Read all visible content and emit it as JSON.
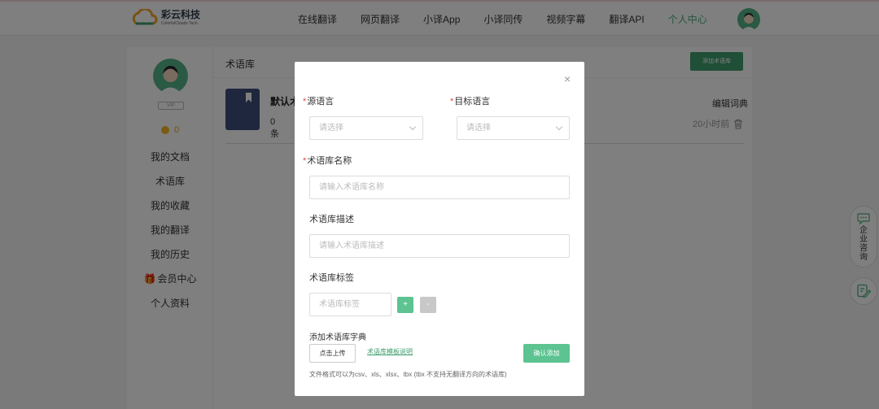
{
  "header": {
    "logo_name": "彩云科技",
    "logo_sub": "ColorfulClouds Tech.",
    "nav": [
      "在线翻译",
      "网页翻译",
      "小译App",
      "小译同传",
      "视频字幕",
      "翻译API",
      "个人中心"
    ],
    "active_nav": "个人中心"
  },
  "sidebar": {
    "vip_label": "VIP",
    "coins": "0",
    "items": [
      "我的文档",
      "术语库",
      "我的收藏",
      "我的翻译",
      "我的历史",
      "会员中心",
      "个人资料"
    ]
  },
  "main": {
    "title": "术语库",
    "add_button": "添加术语库",
    "item": {
      "name": "默认术语库",
      "count": "0条",
      "edit": "编辑词典",
      "time": "20小时前"
    }
  },
  "modal": {
    "close": "×",
    "source_lang_label": "源语言",
    "source_lang_placeholder": "请选择",
    "target_lang_label": "目标语言",
    "target_lang_placeholder": "请选择",
    "name_label": "术语库名称",
    "name_placeholder": "请输入术语库名称",
    "desc_label": "术语库描述",
    "desc_placeholder": "请输入术语库描述",
    "tag_label": "术语库标签",
    "tag_placeholder": "术语库标签",
    "tag_add": "+",
    "tag_remove": "-",
    "dict_label": "添加术语库字典",
    "upload_button": "点击上传",
    "template_link": "术语库模板说明",
    "confirm_button": "确认添加",
    "format_note": "文件格式可以为csv、xls、xlsx、tbx (tbx 不支持无翻译方向的术语库)"
  },
  "float": {
    "consult": "企业咨询"
  },
  "colors": {
    "accent": "#3f9e6d",
    "confirm": "#5cc391",
    "required": "#e5484d"
  }
}
